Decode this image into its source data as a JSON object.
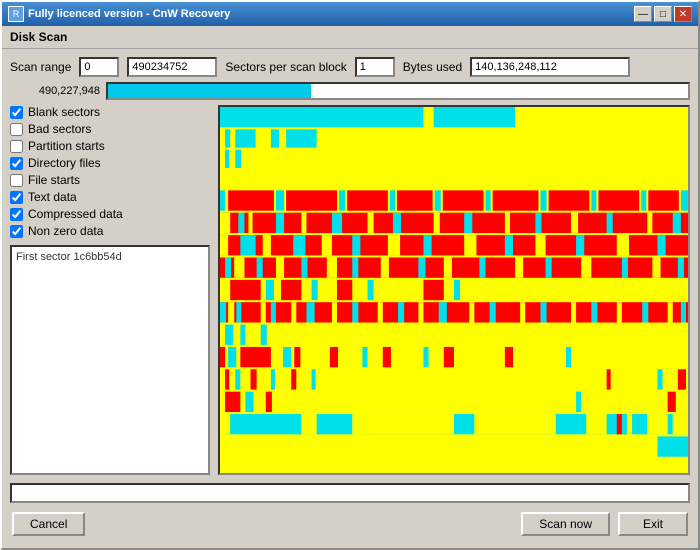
{
  "window": {
    "title": "Fully licenced version - CnW Recovery",
    "dialog_title": "Disk Scan"
  },
  "title_controls": {
    "minimize": "—",
    "maximize": "□",
    "close": "✕"
  },
  "scan_range": {
    "label": "Scan range",
    "start_value": "0",
    "end_value": "490234752",
    "sectors_label": "Sectors per scan block",
    "sectors_value": "1",
    "bytes_label": "Bytes used",
    "bytes_value": "140,136,248,112"
  },
  "progress": {
    "value_label": "490,227,948",
    "percent": 35
  },
  "checkboxes": [
    {
      "id": "blank",
      "label": "Blank sectors",
      "checked": true
    },
    {
      "id": "bad",
      "label": "Bad sectors",
      "checked": false
    },
    {
      "id": "partition",
      "label": "Partition starts",
      "checked": false
    },
    {
      "id": "directory",
      "label": "Directory files",
      "checked": true
    },
    {
      "id": "file",
      "label": "File starts",
      "checked": false
    },
    {
      "id": "text",
      "label": "Text data",
      "checked": true
    },
    {
      "id": "compressed",
      "label": "Compressed data",
      "checked": true
    },
    {
      "id": "nonzero",
      "label": "Non zero data",
      "checked": true
    }
  ],
  "info_box": {
    "text": "First sector 1c6bb54d"
  },
  "status_bar": {
    "text": ""
  },
  "buttons": {
    "cancel": "Cancel",
    "scan_now": "Scan now",
    "exit": "Exit"
  },
  "colors": {
    "yellow": "#ffff00",
    "red": "#ff0000",
    "cyan": "#00e0e8",
    "blue": "#00aaff",
    "white": "#ffffff"
  }
}
